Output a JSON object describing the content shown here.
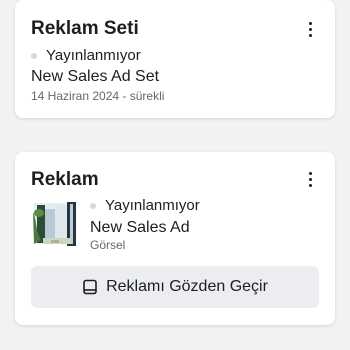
{
  "adset_card": {
    "title": "Reklam Seti",
    "more_icon": "more-vertical-icon",
    "status": "Yayınlanmıyor",
    "name": "New Sales Ad Set",
    "meta": "14 Haziran 2024 - sürekli"
  },
  "ad_card": {
    "title": "Reklam",
    "more_icon": "more-vertical-icon",
    "status": "Yayınlanmıyor",
    "name": "New Sales Ad",
    "type": "Görsel",
    "review_button": {
      "label": "Reklamı Gözden Geçir",
      "icon": "device-preview-icon"
    }
  },
  "colors": {
    "status_dot": "#d6d8db",
    "button_bg": "#ebedf0",
    "secondary_text": "#65676b"
  }
}
